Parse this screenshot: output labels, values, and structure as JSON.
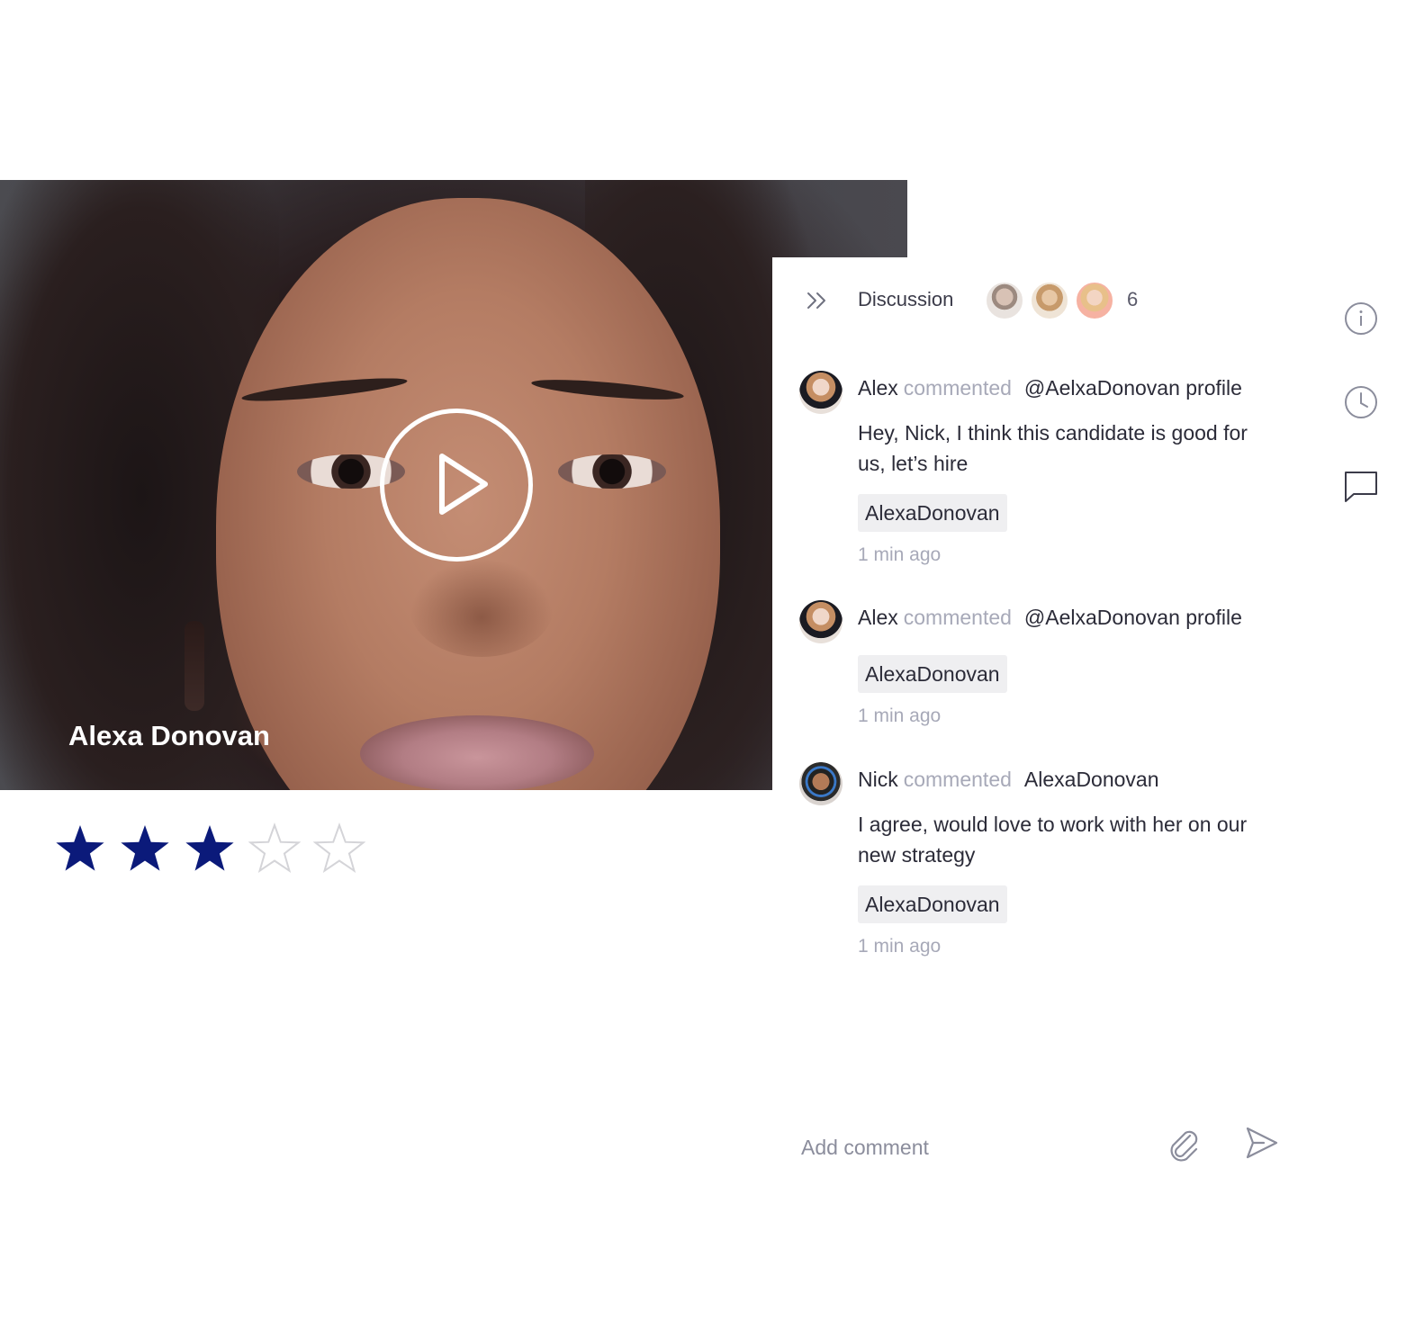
{
  "video": {
    "candidate_name": "Alexa Donovan",
    "play_icon": "play-icon"
  },
  "rating": {
    "value": 3,
    "max": 5,
    "filled_color": "#0b1a7a",
    "empty_color": "#d4d4d8"
  },
  "discussion": {
    "collapse_icon": "double-chevron-right-icon",
    "title": "Discussion",
    "participants_count": "6",
    "comments": [
      {
        "author": "Alex",
        "verb": "commented",
        "reference": "@AelxaDonovan profile",
        "body": "Hey, Nick, I think this candidate is good for us, let’s hire",
        "tag": "AlexaDonovan",
        "time": "1 min ago"
      },
      {
        "author": "Alex",
        "verb": "commented",
        "reference": "@AelxaDonovan profile",
        "body": "",
        "tag": "AlexaDonovan",
        "time": "1 min ago"
      },
      {
        "author": "Nick",
        "verb": "commented",
        "reference": "AlexaDonovan",
        "body": "I agree, would love to work with her on our new strategy",
        "tag": "AlexaDonovan",
        "time": "1 min ago"
      }
    ],
    "composer": {
      "placeholder": "Add comment",
      "attach_icon": "paperclip-icon",
      "send_icon": "send-icon"
    }
  },
  "side_icons": [
    "info-icon",
    "clock-icon",
    "chat-bubble-icon"
  ]
}
